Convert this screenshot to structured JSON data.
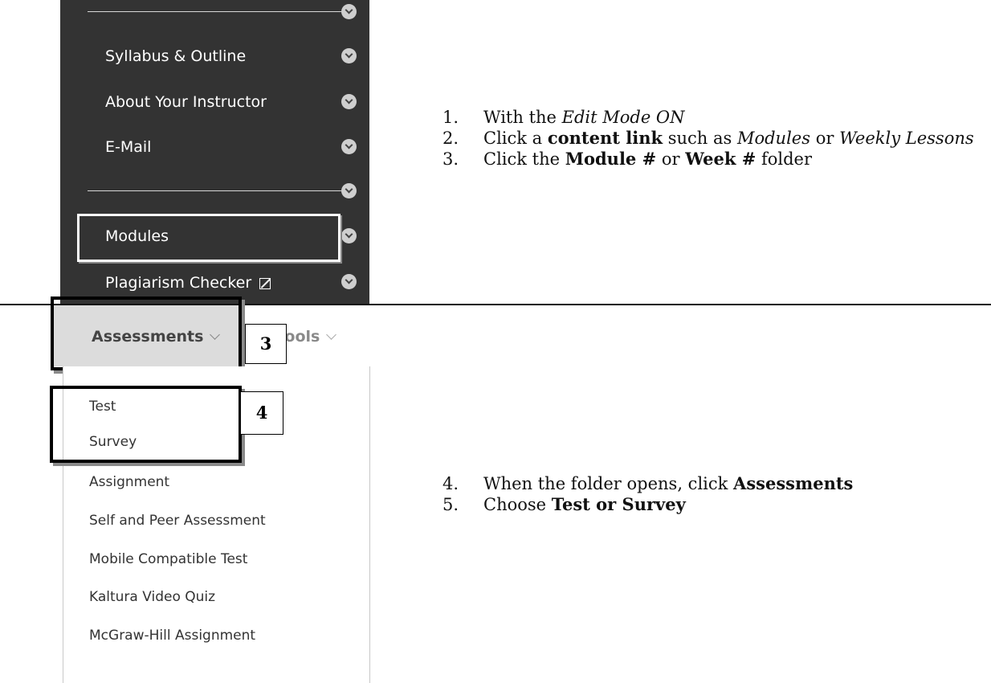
{
  "course_menu": {
    "items": [
      {
        "label": "Syllabus & Outline"
      },
      {
        "label": "About Your Instructor"
      },
      {
        "label": "E-Mail"
      },
      {
        "label": "Modules"
      },
      {
        "label": "Plagiarism Checker"
      }
    ]
  },
  "instructions_top": {
    "steps": [
      {
        "number": "1.",
        "text_before": "With the ",
        "italic": "Edit Mode ON"
      },
      {
        "number": "2.",
        "text_before": "Click a ",
        "bold": "content link",
        "text_middle": " such as ",
        "italic_1": "Modules",
        "text_or": " or ",
        "italic_2": "Weekly Lessons"
      },
      {
        "number": "3.",
        "text_before": "Click the ",
        "bold_1": "Module #",
        "text_or": " or ",
        "bold_2": "Week #",
        "text_after": " folder"
      }
    ]
  },
  "tabs": {
    "assessments": "Assessments",
    "tools": "Tools"
  },
  "badges": {
    "step3": "3",
    "step4": "4"
  },
  "assessments_dropdown": {
    "items": [
      {
        "label": "Test"
      },
      {
        "label": "Survey"
      },
      {
        "label": "Assignment"
      },
      {
        "label": "Self and Peer Assessment"
      },
      {
        "label": "Mobile Compatible Test"
      },
      {
        "label": "Kaltura Video Quiz"
      },
      {
        "label": "McGraw-Hill Assignment"
      }
    ]
  },
  "instructions_bottom": {
    "steps": [
      {
        "number": "4.",
        "text_before": "When the folder opens, click ",
        "bold": "Assessments"
      },
      {
        "number": "5.",
        "text_before": "Choose ",
        "bold": "Test or Survey"
      }
    ]
  }
}
